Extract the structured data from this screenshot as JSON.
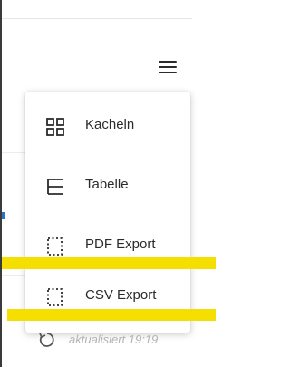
{
  "header": {
    "menu_icon": "hamburger-menu-icon"
  },
  "menu": {
    "items": [
      {
        "label": "Kacheln",
        "icon": "tiles-grid-icon"
      },
      {
        "label": "Tabelle",
        "icon": "table-list-icon"
      },
      {
        "label": "PDF Export",
        "icon": "pdf-export-icon"
      },
      {
        "label": "CSV Export",
        "icon": "csv-export-icon"
      }
    ]
  },
  "status": {
    "updated_text": "aktualisiert 19:19",
    "icon": "refresh-icon"
  },
  "colors": {
    "highlight": "#f5df00",
    "text": "#2b2b2b",
    "muted": "#b3b3b3"
  }
}
